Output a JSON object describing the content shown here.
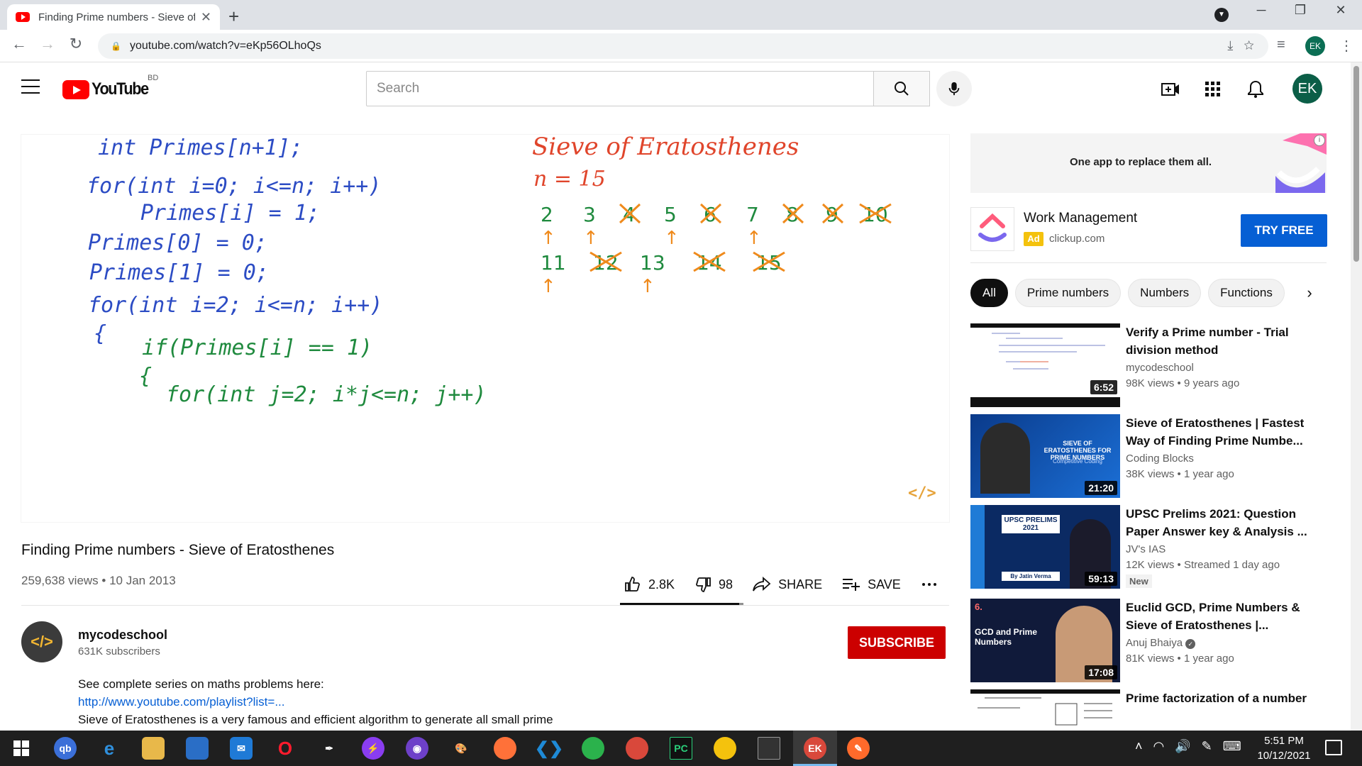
{
  "browser": {
    "tab_title": "Finding Prime numbers - Sieve of",
    "tab_close": "✕",
    "new_tab": "+",
    "url": "youtube.com/watch?v=eKp56OLhoQs",
    "profile_initials": "EK"
  },
  "header": {
    "logo_text": "YouTube",
    "country_code": "BD",
    "search_placeholder": "Search",
    "avatar_initials": "EK"
  },
  "player": {
    "whiteboard_code": [
      "int  Primes[n+1];",
      "for(int i=0; i<=n; i++)",
      "Primes[i] = 1;",
      "Primes[0] = 0;",
      "Primes[1] = 0;",
      "for(int  i=2; i<=n; i++)",
      "{",
      "if(Primes[i] == 1)",
      "{",
      "for(int j=2; i*j<=n; j++)"
    ],
    "whiteboard_title": "Sieve of Eratosthenes",
    "whiteboard_n": "n = 15",
    "sieve_row1": [
      "2",
      "3",
      "4",
      "5",
      "6",
      "7",
      "8",
      "9",
      "10"
    ],
    "sieve_row2": [
      "11",
      "12",
      "13",
      "14",
      "15"
    ],
    "watermark": "</>"
  },
  "video": {
    "title": "Finding Prime numbers - Sieve of Eratosthenes",
    "meta": "259,638 views • 10 Jan 2013",
    "likes": "2.8K",
    "dislikes": "98",
    "share_label": "SHARE",
    "save_label": "SAVE",
    "like_ratio": 0.966
  },
  "channel": {
    "name": "mycodeschool",
    "subscribers": "631K subscribers",
    "subscribe_label": "SUBSCRIBE",
    "avatar_text": "</>"
  },
  "description": {
    "line1": "See complete series on maths problems here:",
    "link": "http://www.youtube.com/playlist?list=...",
    "line3": "Sieve of Eratosthenes is a very famous and efficient algorithm to generate all small prime"
  },
  "ad": {
    "banner_tagline": "One app to replace them all.",
    "title": "Work Management",
    "badge": "Ad",
    "domain": "clickup.com",
    "cta": "TRY FREE",
    "info": "i"
  },
  "chips": [
    "All",
    "Prime numbers",
    "Numbers",
    "Functions"
  ],
  "recommendations": [
    {
      "title": "Verify a Prime number - Trial division method",
      "channel": "mycodeschool",
      "meta": "98K views • 9 years ago",
      "duration": "6:52"
    },
    {
      "title": "Sieve of Eratosthenes | Fastest Way of Finding Prime Numbe...",
      "channel": "Coding Blocks",
      "meta": "38K views • 1 year ago",
      "duration": "21:20"
    },
    {
      "title": "UPSC Prelims 2021: Question Paper Answer key & Analysis ...",
      "channel": "JV's IAS",
      "meta": "12K views • Streamed 1 day ago",
      "duration": "59:13",
      "badge": "New"
    },
    {
      "title": "Euclid GCD, Prime Numbers & Sieve of Eratosthenes |...",
      "channel": "Anuj Bhaiya",
      "meta": "81K views • 1 year ago",
      "duration": "17:08"
    },
    {
      "title": "Prime factorization of a number",
      "channel": "",
      "meta": "",
      "duration": ""
    }
  ],
  "thumb_text": {
    "t1": "SIEVE OF ERATOSTHENES FOR PRIME NUMBERS",
    "t1b": "Competitive Coding",
    "t2": "UPSC PRELIMS 2021",
    "t2b": "By Jatin Verma",
    "t3": "GCD and Prime Numbers",
    "t3b": "6."
  },
  "taskbar": {
    "time": "5:51 PM",
    "date": "10/12/2021"
  }
}
